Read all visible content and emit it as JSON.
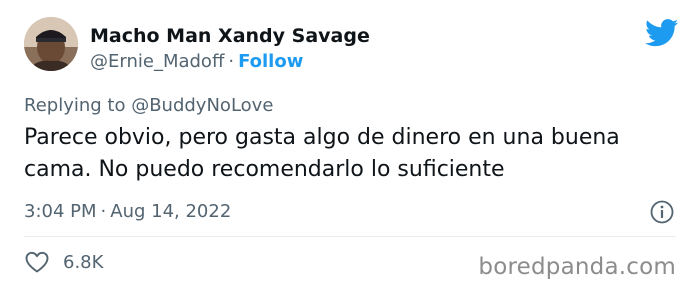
{
  "author": {
    "display_name": "Macho Man Xandy Savage",
    "handle": "@Ernie_Madoff",
    "separator": "·",
    "follow_label": "Follow"
  },
  "reply": {
    "prefix": "Replying to ",
    "handle": "@BuddyNoLove"
  },
  "tweet": {
    "text": "Parece obvio, pero gasta algo de dinero en una buena cama. No puedo recomendarlo lo suficiente"
  },
  "meta": {
    "time": "3:04 PM",
    "separator": "·",
    "date": "Aug 14, 2022"
  },
  "engagement": {
    "likes": "6.8K"
  },
  "watermark": "boredpanda.com",
  "icons": {
    "brand": "twitter-bird-icon",
    "info": "info-icon",
    "like": "heart-icon"
  },
  "colors": {
    "accent": "#1d9bf0",
    "secondary_text": "#536471",
    "primary_text": "#0f1419"
  }
}
